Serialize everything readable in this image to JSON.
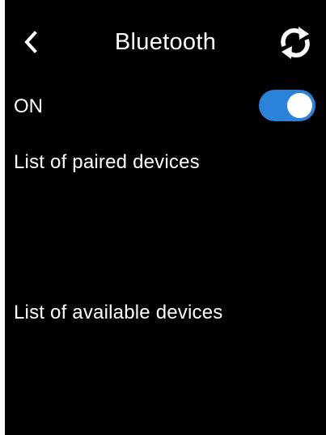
{
  "header": {
    "back_icon": "chevron-left-icon",
    "title": "Bluetooth",
    "refresh_icon": "refresh-icon"
  },
  "bluetooth": {
    "status_label": "ON",
    "enabled": true
  },
  "sections": {
    "paired_label": "List of paired devices",
    "available_label": "List of available devices"
  },
  "colors": {
    "background": "#000000",
    "text": "#ffffff",
    "toggle_on": "#2b82d9"
  }
}
